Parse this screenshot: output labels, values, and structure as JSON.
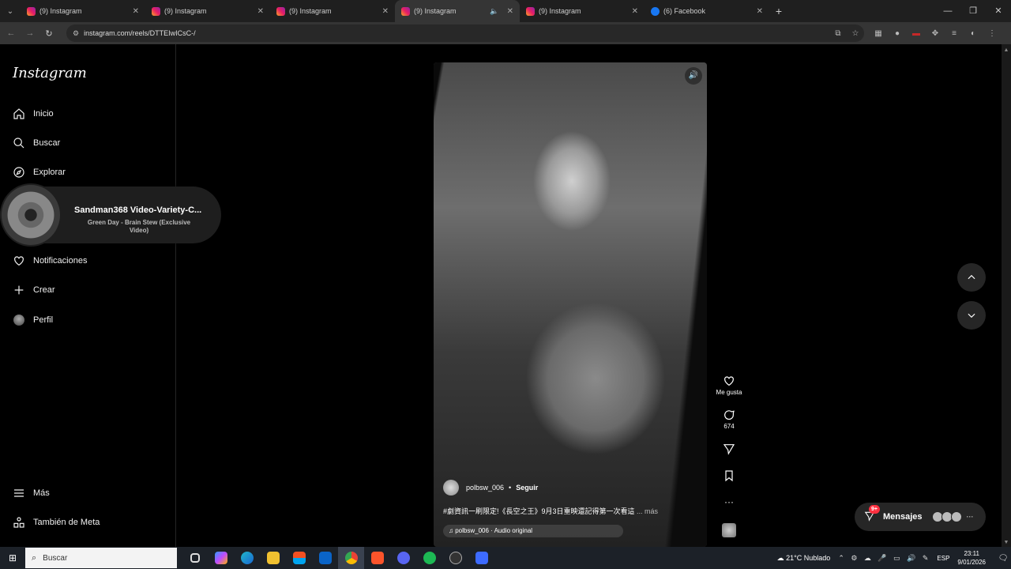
{
  "browser": {
    "tabs": [
      {
        "title": "(9) Instagram",
        "type": "ig",
        "active": false
      },
      {
        "title": "(9) Instagram",
        "type": "ig",
        "active": false
      },
      {
        "title": "(9) Instagram",
        "type": "ig",
        "active": false
      },
      {
        "title": "(9) Instagram",
        "type": "ig",
        "active": true
      },
      {
        "title": "(9) Instagram",
        "type": "ig",
        "active": false
      },
      {
        "title": "(6) Facebook",
        "type": "fb",
        "active": false
      }
    ],
    "url": "instagram.com/reels/DTTEIwICsC-/"
  },
  "sidebar": {
    "logo": "Instagram",
    "items": [
      {
        "label": "Inicio",
        "icon": "home-icon"
      },
      {
        "label": "Buscar",
        "icon": "search-icon"
      },
      {
        "label": "Explorar",
        "icon": "compass-icon"
      },
      {
        "label": "Notificaciones",
        "icon": "heart-icon"
      },
      {
        "label": "Crear",
        "icon": "plus-icon"
      },
      {
        "label": "Perfil",
        "icon": "avatar-icon"
      }
    ],
    "bottom": [
      {
        "label": "Más",
        "icon": "menu-icon"
      },
      {
        "label": "También de Meta",
        "icon": "meta-grid-icon"
      }
    ]
  },
  "mini_player": {
    "title": "Sandman368 Video-Variety-C...",
    "subtitle": "Green Day - Brain Stew (Exclusive Video)"
  },
  "reel": {
    "username": "polbsw_006",
    "separator": "•",
    "follow": "Seguir",
    "caption": "#劇資訊一刷限定!《長空之王》9月3日重映還記得第一次看這",
    "more": "... más",
    "audio": "♫ polbsw_006 · Audio original"
  },
  "actions": {
    "like_label": "Me gusta",
    "comments_count": "674"
  },
  "messages": {
    "label": "Mensajes",
    "badge": "9+"
  },
  "taskbar": {
    "search_placeholder": "Buscar",
    "weather": "21°C  Nublado",
    "lang": "ESP",
    "time": "23:11",
    "date": "9/01/2026"
  }
}
